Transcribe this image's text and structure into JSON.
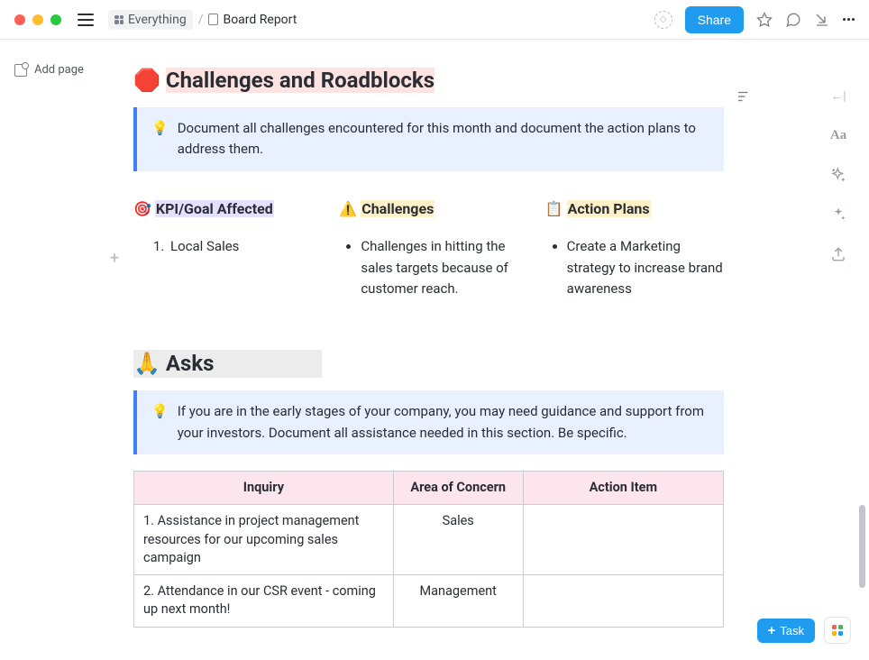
{
  "topbar": {
    "breadcrumb": {
      "root": "Everything",
      "current": "Board Report"
    },
    "share": "Share"
  },
  "sidebar": {
    "addPage": "Add page"
  },
  "section1": {
    "emoji": "🛑",
    "title": "Challenges and Roadblocks",
    "calloutIcon": "💡",
    "callout": "Document all challenges encountered for this month and document the action plans to address them.",
    "col1": {
      "emoji": "🎯",
      "label": "KPI/Goal Affected",
      "item": "Local Sales"
    },
    "col2": {
      "emoji": "⚠️",
      "label": "Challenges",
      "item": "Challenges in hitting the sales targets because of customer reach."
    },
    "col3": {
      "emoji": "📋",
      "label": "Action Plans",
      "item": "Create a Marketing strategy to increase brand awareness"
    }
  },
  "section2": {
    "emoji": "🙏",
    "title": "Asks",
    "calloutIcon": "💡",
    "callout": "If you are in the early stages of your company, you may need guidance and support from your investors. Document all assistance needed in this section. Be specific.",
    "table": {
      "headers": {
        "inquiry": "Inquiry",
        "area": "Area of Concern",
        "action": "Action Item"
      },
      "rows": [
        {
          "inquiry": "1. Assistance in project management resources for our upcoming sales campaign",
          "area": "Sales",
          "action": ""
        },
        {
          "inquiry": "2. Attendance in our CSR event - coming up next month!",
          "area": "Management",
          "action": ""
        }
      ]
    }
  },
  "floating": {
    "task": "Task"
  }
}
